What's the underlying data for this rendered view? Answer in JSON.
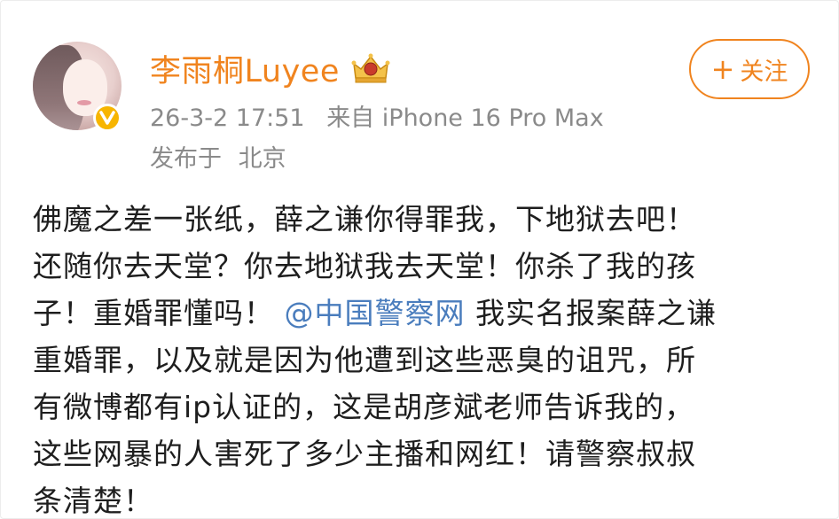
{
  "user": {
    "name": "李雨桐Luyee",
    "avatar_icon": "avatar",
    "verified_icon": "verified-badge-icon",
    "rank_icon": "crown-rank-icon"
  },
  "meta": {
    "time": "26-3-2 17:51",
    "source_prefix": "来自",
    "source_device": "iPhone 16 Pro Max",
    "location_prefix": "发布于",
    "location": "北京"
  },
  "follow_button": {
    "plus": "+",
    "label": "关注"
  },
  "post": {
    "line1": "佛魔之差一张纸，薛之谦你得罪我，下地狱去吧！",
    "line2": "还随你去天堂？你去地狱我去天堂！你杀了我的孩",
    "line3_a": "子！重婚罪懂吗！",
    "line3_mention": "@中国警察网",
    "line3_b": "我实名报案薛之谦",
    "line4": "重婚罪，以及就是因为他遭到这些恶臭的诅咒，所",
    "line5": "有微博都有ip认证的，这是胡彦斌老师告诉我的，",
    "line6": "这些网暴的人害死了多少主播和网红！请警察叔叔",
    "line7": "条清楚！"
  },
  "colors": {
    "accent": "#f0841f",
    "mention": "#4a7dbd",
    "meta": "#8a8a8a",
    "verified": "#f7b500"
  }
}
